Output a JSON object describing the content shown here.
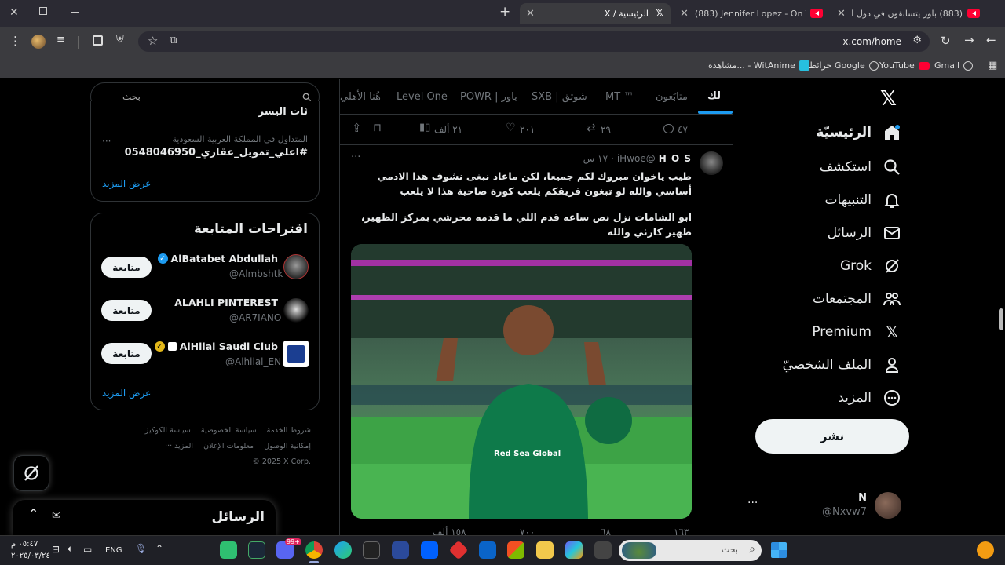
{
  "browser": {
    "tabs": [
      {
        "title": "(883) باور يتسابقون في دول أورو",
        "favicon": "youtube-icon"
      },
      {
        "title": "(883) Jennifer Lopez - On The Floor",
        "favicon": "youtube-icon"
      },
      {
        "title": "الرئيسية / X",
        "favicon": "x-icon",
        "active": true
      }
    ],
    "url": "x.com/home",
    "bookmarks": [
      "Gmail",
      "YouTube",
      "خرائط Google",
      "مشاهدة... - WitAnime"
    ]
  },
  "sidebar": {
    "items": [
      {
        "label": "الرئيسيّة",
        "icon": "home-icon"
      },
      {
        "label": "استكشف",
        "icon": "search-icon"
      },
      {
        "label": "التنبيهات",
        "icon": "bell-icon"
      },
      {
        "label": "الرسائل",
        "icon": "mail-icon"
      },
      {
        "label": "Grok",
        "icon": "grok-icon"
      },
      {
        "label": "المجتمعات",
        "icon": "communities-icon"
      },
      {
        "label": "Premium",
        "icon": "x-icon"
      },
      {
        "label": "الملف الشخصيّ",
        "icon": "profile-icon"
      },
      {
        "label": "المزيد",
        "icon": "more-icon"
      }
    ],
    "post_button": "نشر",
    "account": {
      "name": "N",
      "handle": "@Nxvw7"
    }
  },
  "feed": {
    "tabs": [
      "لك",
      "متابَعون",
      "MT ™",
      "شوتق | SXB",
      "باور | POWR",
      "Level One",
      "هُنا الأهلي"
    ],
    "prev_actions": {
      "replies": "٤٧",
      "reposts": "٢٩",
      "likes": "٢٠١",
      "views": "٢١ ألف"
    },
    "post": {
      "name": "H O S",
      "handle": "@iHwoe",
      "time": "١٧ س",
      "separator": "·",
      "text1": "طيب ياخوان مبروك لكم جميعا، لكن ماعاد نبغى نشوف هذا الادمي أساسي والله لو تبغون فريقكم يلعب كورة صاحية هذا لا يلعب",
      "text2": "ابو الشامات نزل نص ساعه قدم اللي ما قدمه مجرشي بمركز الظهير، ظهير كارثي والله",
      "jersey_text": "Red Sea Global",
      "actions": {
        "replies": "١٦٣",
        "reposts": "٦٨",
        "likes": "٧٠٠",
        "views": "١٥٨ ألف"
      }
    }
  },
  "right": {
    "search_placeholder": "بحث",
    "trend": {
      "title": "ثات اليسر",
      "meta": "المتداول في المملكة العربية السعودية",
      "name": "#اعلي_تمويل_عقاري_0548046950"
    },
    "show_more": "عرض المزيد",
    "follow_title": "اقتراحات المتابعة",
    "suggestions": [
      {
        "name": "AlBatabet Abdullah",
        "handle": "@Almbshtk",
        "button": "متابعة",
        "verified": "blue"
      },
      {
        "name": "ALAHLI PINTEREST",
        "handle": "@AR7IANO",
        "button": "متابعة",
        "verified": ""
      },
      {
        "name": "AlHilal Saudi Club",
        "handle": "@Alhilal_EN",
        "button": "متابعة",
        "verified": "gold"
      }
    ],
    "footer": [
      "شروط الخدمة",
      "سياسة الخصوصية",
      "سياسة الكوكيز",
      "إمكانية الوصول",
      "معلومات الإعلان",
      "المزيد ···",
      "© 2025 X Corp."
    ],
    "messages_drawer": "الرسائل"
  },
  "taskbar": {
    "time": "٠٥:٤٧ م",
    "date": "٢٠٢٥/٠٣/٢٤",
    "lang": "ENG",
    "search_placeholder": "بحث",
    "badge": "99+"
  }
}
